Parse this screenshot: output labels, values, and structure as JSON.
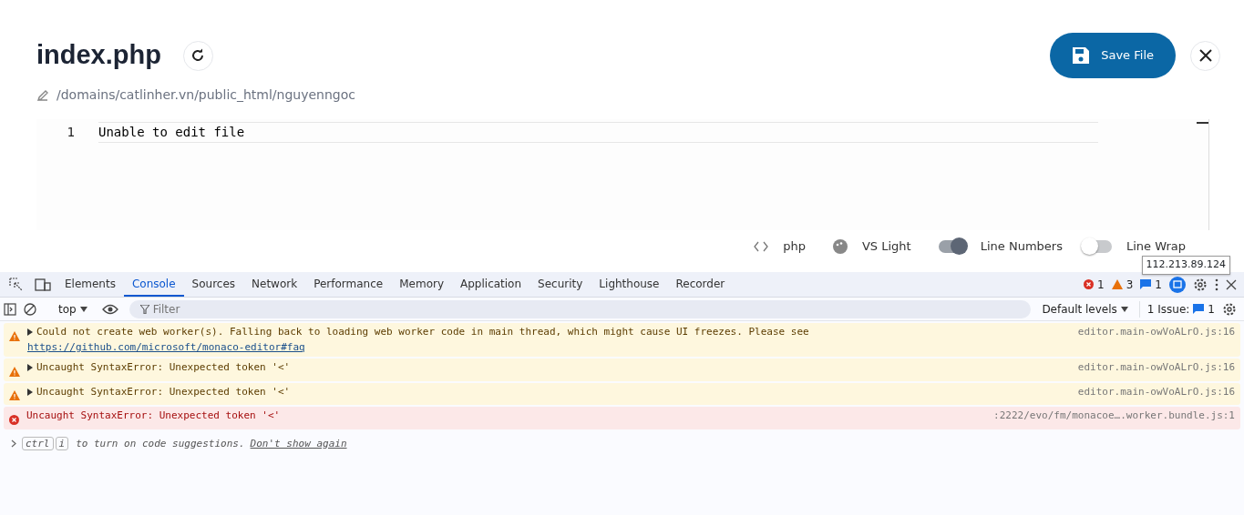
{
  "file": {
    "title": "index.php",
    "path": "/domains/catlinher.vn/public_html/nguyenngoc"
  },
  "save_button": "Save File",
  "editor": {
    "lines": [
      {
        "number": "1",
        "text": "Unable to edit file"
      }
    ]
  },
  "status": {
    "language": "php",
    "theme": "VS Light",
    "toggles": [
      {
        "label": "Line Numbers",
        "on": true
      },
      {
        "label": "Line Wrap",
        "on": false
      }
    ]
  },
  "tooltip": "112.213.89.124",
  "devtools": {
    "tabs": [
      {
        "label": "Elements",
        "selected": false
      },
      {
        "label": "Console",
        "selected": true
      },
      {
        "label": "Sources",
        "selected": false
      },
      {
        "label": "Network",
        "selected": false
      },
      {
        "label": "Performance",
        "selected": false
      },
      {
        "label": "Memory",
        "selected": false
      },
      {
        "label": "Application",
        "selected": false
      },
      {
        "label": "Security",
        "selected": false
      },
      {
        "label": "Lighthouse",
        "selected": false
      },
      {
        "label": "Recorder",
        "selected": false
      }
    ],
    "counts": {
      "errors": "1",
      "warnings": "3",
      "infos": "1"
    },
    "context": "top",
    "filter_placeholder": "Filter",
    "levels": "Default levels",
    "issues_label": "1 Issue:",
    "issues_count": "1",
    "messages": [
      {
        "kind": "warning",
        "expandable": true,
        "text": "Could not create web worker(s). Falling back to loading web worker code in main thread, which might cause UI freezes. Please see",
        "link": "https://github.com/microsoft/monaco-editor#faq",
        "source": "editor.main-owVoALrO.js:16"
      },
      {
        "kind": "warning",
        "expandable": true,
        "text": "Uncaught SyntaxError: Unexpected token '<'",
        "source": "editor.main-owVoALrO.js:16"
      },
      {
        "kind": "warning",
        "expandable": true,
        "text": "Uncaught SyntaxError: Unexpected token '<'",
        "source": "editor.main-owVoALrO.js:16"
      },
      {
        "kind": "error",
        "expandable": false,
        "text": "Uncaught SyntaxError: Unexpected token '<'",
        "source": ":2222/evo/fm/monacoe….worker.bundle.js:1"
      }
    ],
    "suggestion": {
      "keys": [
        "ctrl",
        "i"
      ],
      "text": "to turn on code suggestions.",
      "link": "Don't show again"
    }
  }
}
